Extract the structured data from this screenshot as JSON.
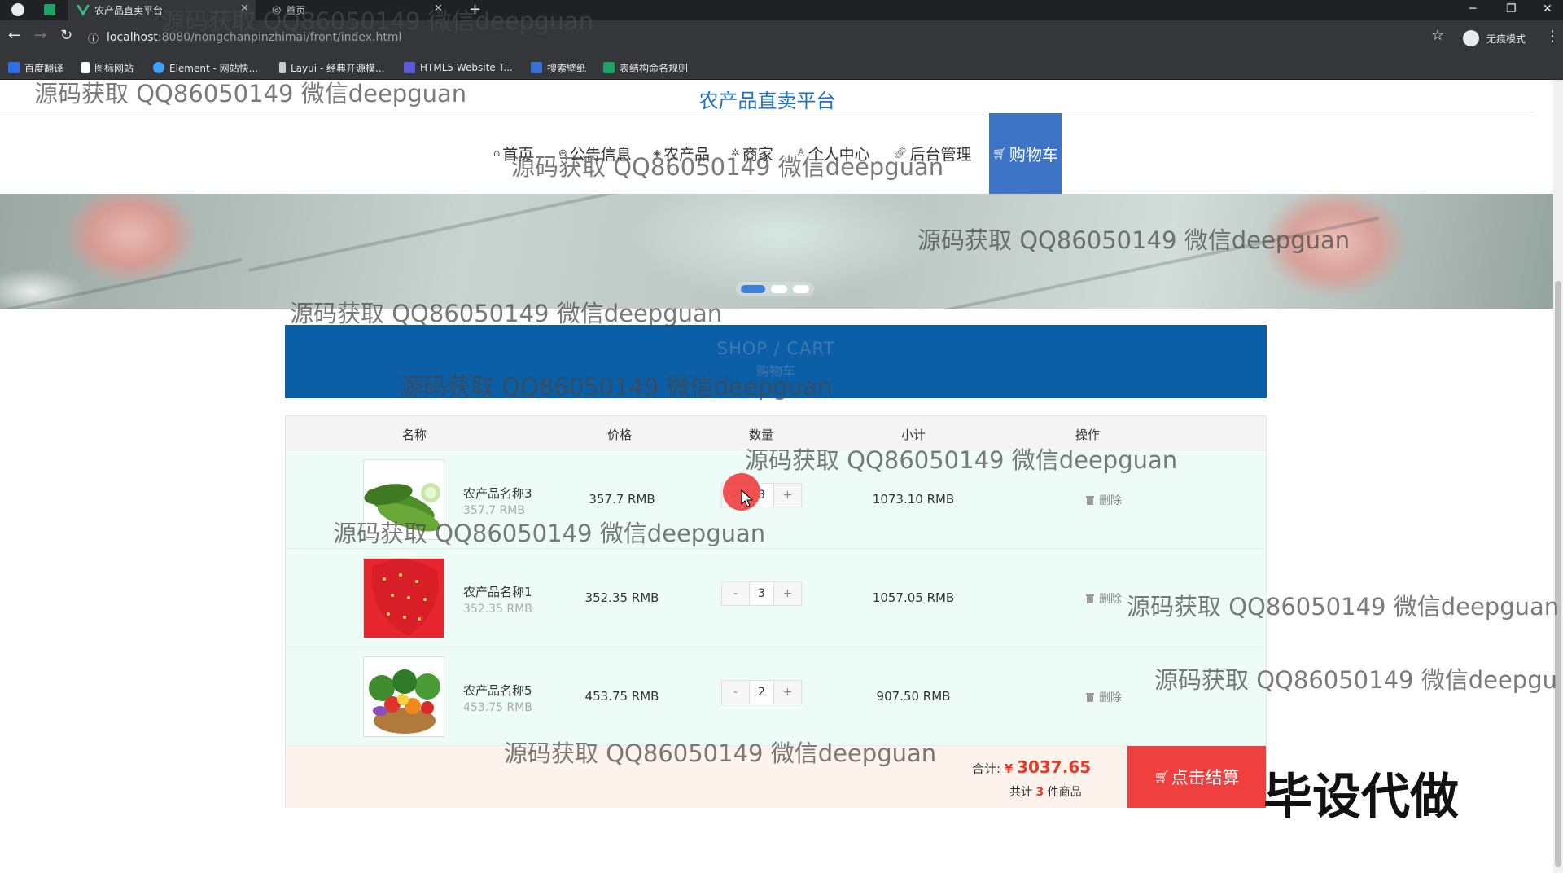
{
  "browser": {
    "tabs": [
      {
        "title": "农产品直卖平台"
      },
      {
        "title": "首页"
      }
    ],
    "url_host": "localhost",
    "url_path": ":8080/nongchanpinzhimai/front/index.html",
    "incognito_label": "无痕模式",
    "bookmarks": [
      {
        "label": "百度翻译",
        "color": "#2f6fe3"
      },
      {
        "label": "图标网站",
        "color": "#ffffff"
      },
      {
        "label": "Element - 网站快...",
        "color": "#409eff"
      },
      {
        "label": "Layui - 经典开源模...",
        "color": "#cccccc"
      },
      {
        "label": "HTML5 Website T...",
        "color": "#5b5bd6"
      },
      {
        "label": "搜索壁纸",
        "color": "#3b6fd6"
      },
      {
        "label": "表结构命名规则",
        "color": "#1ea362"
      }
    ]
  },
  "site": {
    "title": "农产品直卖平台",
    "nav": [
      {
        "label": "首页",
        "icon": "home-icon"
      },
      {
        "label": "公告信息",
        "icon": "globe-icon"
      },
      {
        "label": "农产品",
        "icon": "tag-icon"
      },
      {
        "label": "商家",
        "icon": "settings-icon"
      },
      {
        "label": "个人中心",
        "icon": "user-icon"
      },
      {
        "label": "后台管理",
        "icon": "link-icon"
      }
    ],
    "nav_active": {
      "label": "购物车",
      "icon": "cart-icon"
    },
    "accent": "#3d74c6"
  },
  "cart": {
    "header_en": "SHOP / CART",
    "header_cn": "购物车",
    "columns": [
      "名称",
      "价格",
      "数量",
      "小计",
      "操作"
    ],
    "items": [
      {
        "name": "农产品名称3",
        "unit_price": "357.7 RMB",
        "price": "357.7 RMB",
        "qty": "3",
        "subtotal": "1073.10 RMB",
        "action": "删除",
        "image": "cucumber"
      },
      {
        "name": "农产品名称1",
        "unit_price": "352.35 RMB",
        "price": "352.35 RMB",
        "qty": "3",
        "subtotal": "1057.05 RMB",
        "action": "删除",
        "image": "strawberry"
      },
      {
        "name": "农产品名称5",
        "unit_price": "453.75 RMB",
        "price": "453.75 RMB",
        "qty": "2",
        "subtotal": "907.50 RMB",
        "action": "删除",
        "image": "vegetable-basket"
      }
    ],
    "minus": "-",
    "plus": "+",
    "total_label": "合计:",
    "currency": "¥",
    "total": "3037.65",
    "count_prefix": "共计",
    "count": "3",
    "count_suffix": "件商品",
    "checkout_label": "点击结算",
    "checkout_color": "#ef3f3f"
  },
  "overlay": {
    "watermark": "源码获取 QQ86050149 微信deepguan",
    "watermark_cut": "源码获取 QQ86050149 微信deepgu",
    "tag": "毕设代做"
  }
}
